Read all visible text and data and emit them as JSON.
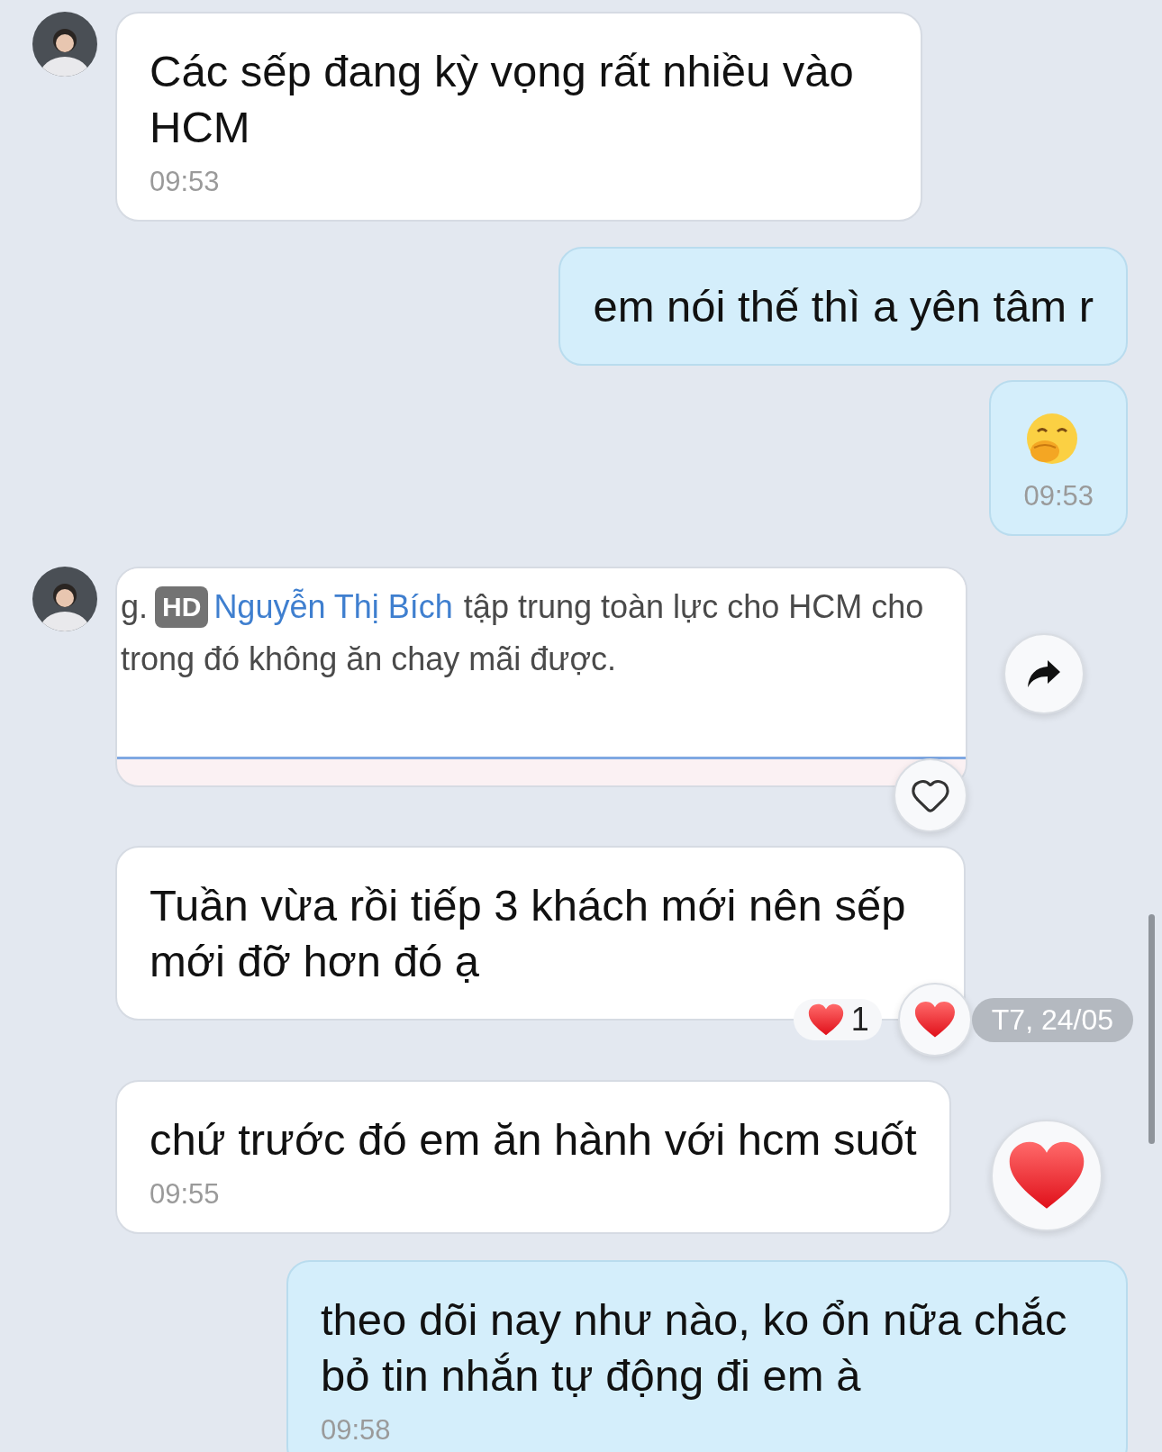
{
  "messages": [
    {
      "kind": "text",
      "from_me": false,
      "avatar": true,
      "text": "Các sếp đang kỳ vọng rất nhiều vào HCM",
      "time": "09:53"
    },
    {
      "kind": "text",
      "from_me": true,
      "text": "em nói thế thì a yên tâm r"
    },
    {
      "kind": "emoji",
      "from_me": true,
      "time": "09:53"
    },
    {
      "kind": "image",
      "from_me": false,
      "avatar": true,
      "badge": "HD",
      "line_1": {
        "prefix": "g.",
        "mention": "Nguyễn Thị Bích",
        "rest": "tập trung toàn lực cho HCM cho"
      },
      "line_2": "trong đó không ăn chay mãi được.",
      "forward_button": true,
      "like_button": {
        "liked": false
      }
    },
    {
      "kind": "text",
      "from_me": false,
      "avatar": false,
      "text": "Tuần vừa rồi tiếp 3 khách mới nên sếp mới đỡ hơn đó ạ",
      "reactions": {
        "count": "1"
      },
      "like_button": {
        "liked": true
      },
      "date": "T7, 24/05"
    },
    {
      "kind": "text",
      "from_me": false,
      "avatar": false,
      "text": "chứ trước đó em ăn hành với hcm suốt",
      "time": "09:55",
      "quick_heart": true
    },
    {
      "kind": "text",
      "from_me": true,
      "text": "theo dõi nay như nào, ko ổn nữa chắc bỏ tin nhắn tự động đi em à",
      "time": "09:58"
    }
  ]
}
